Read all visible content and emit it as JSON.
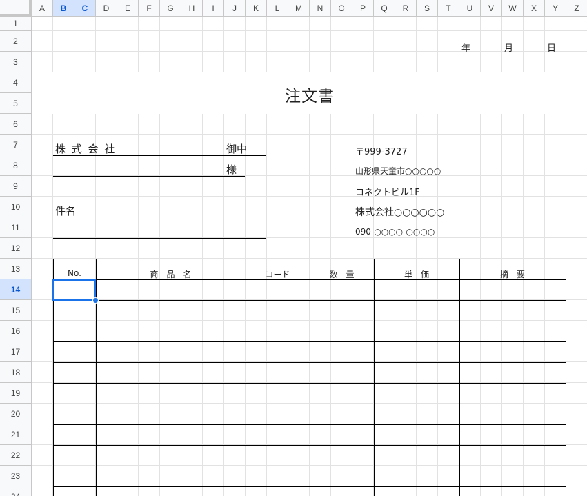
{
  "spreadsheet": {
    "columns": [
      "A",
      "B",
      "C",
      "D",
      "E",
      "F",
      "G",
      "H",
      "I",
      "J",
      "K",
      "L",
      "M",
      "N",
      "O",
      "P",
      "Q",
      "R",
      "S",
      "T",
      "U",
      "V",
      "W",
      "X",
      "Y",
      "Z"
    ],
    "rows": [
      "1",
      "2",
      "3",
      "4",
      "5",
      "6",
      "7",
      "8",
      "9",
      "10",
      "11",
      "12",
      "13",
      "14",
      "15",
      "16",
      "17",
      "18",
      "19",
      "20",
      "21",
      "22",
      "23",
      "24"
    ],
    "selected_cell": "B14"
  },
  "order_form": {
    "date_year": "年",
    "date_month": "月",
    "date_day": "日",
    "title": "注文書",
    "customer_company": "株 式 会 社",
    "customer_honorific_1": "御中",
    "customer_honorific_2": "様",
    "subject_label": "件名",
    "sender_postal": "〒999-3727",
    "sender_address": "山形県天童市○○○○○",
    "sender_building": "コネクトビル1F",
    "sender_company": "株式会社○○○○○○",
    "sender_phone": "090-○○○○-○○○○",
    "table_headers": [
      "No.",
      "商　品　名",
      "コード",
      "数　量",
      "単　価",
      "摘　要"
    ]
  }
}
